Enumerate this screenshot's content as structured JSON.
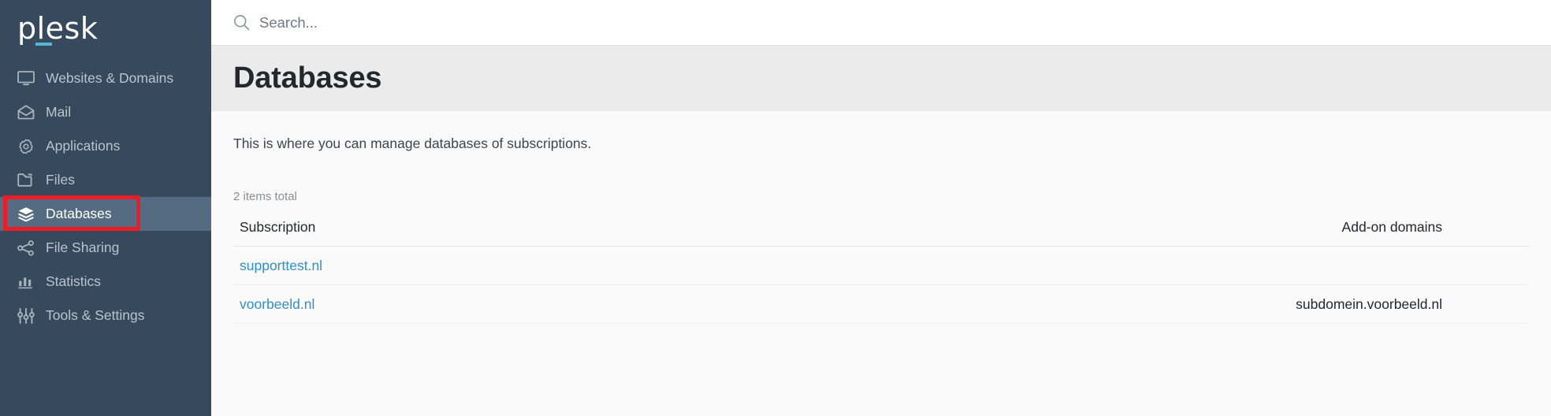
{
  "brand": {
    "logo_text": "plesk",
    "accent_color": "#53b6d8",
    "sidebar_color": "#37495c",
    "active_color": "#546b82",
    "annotation_color": "#ee1c25",
    "link_color": "#2f8fcc"
  },
  "sidebar": {
    "items": [
      {
        "label": "Websites & Domains",
        "icon": "monitor-icon",
        "active": false
      },
      {
        "label": "Mail",
        "icon": "envelope-icon",
        "active": false
      },
      {
        "label": "Applications",
        "icon": "gear-icon",
        "active": false
      },
      {
        "label": "Files",
        "icon": "folder-icon",
        "active": false
      },
      {
        "label": "Databases",
        "icon": "layers-icon",
        "active": true
      },
      {
        "label": "File Sharing",
        "icon": "share-nodes-icon",
        "active": false
      },
      {
        "label": "Statistics",
        "icon": "bar-chart-icon",
        "active": false
      },
      {
        "label": "Tools & Settings",
        "icon": "sliders-icon",
        "active": false
      }
    ]
  },
  "topbar": {
    "search": {
      "placeholder": "Search...",
      "value": "",
      "icon": "search-icon"
    }
  },
  "page": {
    "title": "Databases",
    "description": "This is where you can manage databases of subscriptions.",
    "items_total": "2 items total"
  },
  "table": {
    "columns": [
      {
        "key": "subscription",
        "label": "Subscription"
      },
      {
        "key": "addon",
        "label": "Add-on domains"
      }
    ],
    "rows": [
      {
        "subscription": "supporttest.nl",
        "addon": ""
      },
      {
        "subscription": "voorbeeld.nl",
        "addon": "subdomein.voorbeeld.nl"
      }
    ]
  }
}
